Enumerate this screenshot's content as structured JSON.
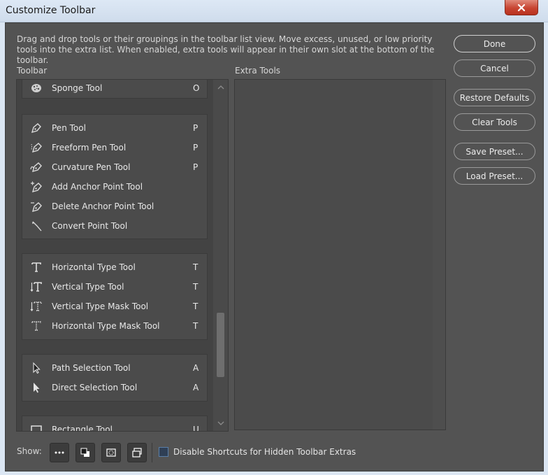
{
  "window": {
    "title": "Customize Toolbar"
  },
  "intro_text": "Drag and drop tools or their groupings in the toolbar list view. Move excess, unused, or low priority tools into the extra list. When enabled, extra tools will appear in their own slot at the bottom of the toolbar.",
  "labels": {
    "toolbar": "Toolbar",
    "extra_tools": "Extra Tools"
  },
  "buttons": {
    "done": "Done",
    "cancel": "Cancel",
    "restore_defaults": "Restore Defaults",
    "clear_tools": "Clear Tools",
    "save_preset": "Save Preset...",
    "load_preset": "Load Preset..."
  },
  "tool_groups": [
    {
      "tools": [
        {
          "name": "Sponge Tool",
          "shortcut": "O",
          "icon": "sponge-icon"
        }
      ]
    },
    {
      "tools": [
        {
          "name": "Pen Tool",
          "shortcut": "P",
          "icon": "pen-icon"
        },
        {
          "name": "Freeform Pen Tool",
          "shortcut": "P",
          "icon": "freeform-pen-icon"
        },
        {
          "name": "Curvature Pen Tool",
          "shortcut": "P",
          "icon": "curvature-pen-icon"
        },
        {
          "name": "Add Anchor Point Tool",
          "shortcut": "",
          "icon": "add-anchor-icon"
        },
        {
          "name": "Delete Anchor Point Tool",
          "shortcut": "",
          "icon": "delete-anchor-icon"
        },
        {
          "name": "Convert Point Tool",
          "shortcut": "",
          "icon": "convert-point-icon"
        }
      ]
    },
    {
      "tools": [
        {
          "name": "Horizontal Type Tool",
          "shortcut": "T",
          "icon": "horizontal-type-icon"
        },
        {
          "name": "Vertical Type Tool",
          "shortcut": "T",
          "icon": "vertical-type-icon"
        },
        {
          "name": "Vertical Type Mask Tool",
          "shortcut": "T",
          "icon": "vertical-type-mask-icon"
        },
        {
          "name": "Horizontal Type Mask Tool",
          "shortcut": "T",
          "icon": "horizontal-type-mask-icon"
        }
      ]
    },
    {
      "tools": [
        {
          "name": "Path Selection Tool",
          "shortcut": "A",
          "icon": "path-selection-icon"
        },
        {
          "name": "Direct Selection Tool",
          "shortcut": "A",
          "icon": "direct-selection-icon"
        }
      ]
    },
    {
      "tools": [
        {
          "name": "Rectangle Tool",
          "shortcut": "U",
          "icon": "rectangle-icon"
        }
      ]
    }
  ],
  "footer": {
    "show_label": "Show:",
    "show_buttons": [
      "more-icon",
      "color-swatches-icon",
      "quick-mask-icon",
      "screen-mode-icon"
    ],
    "checkbox_label": "Disable Shortcuts for Hidden Toolbar Extras",
    "checkbox_checked": false
  },
  "colors": {
    "background": "#535353",
    "close_button": "#c84532"
  }
}
